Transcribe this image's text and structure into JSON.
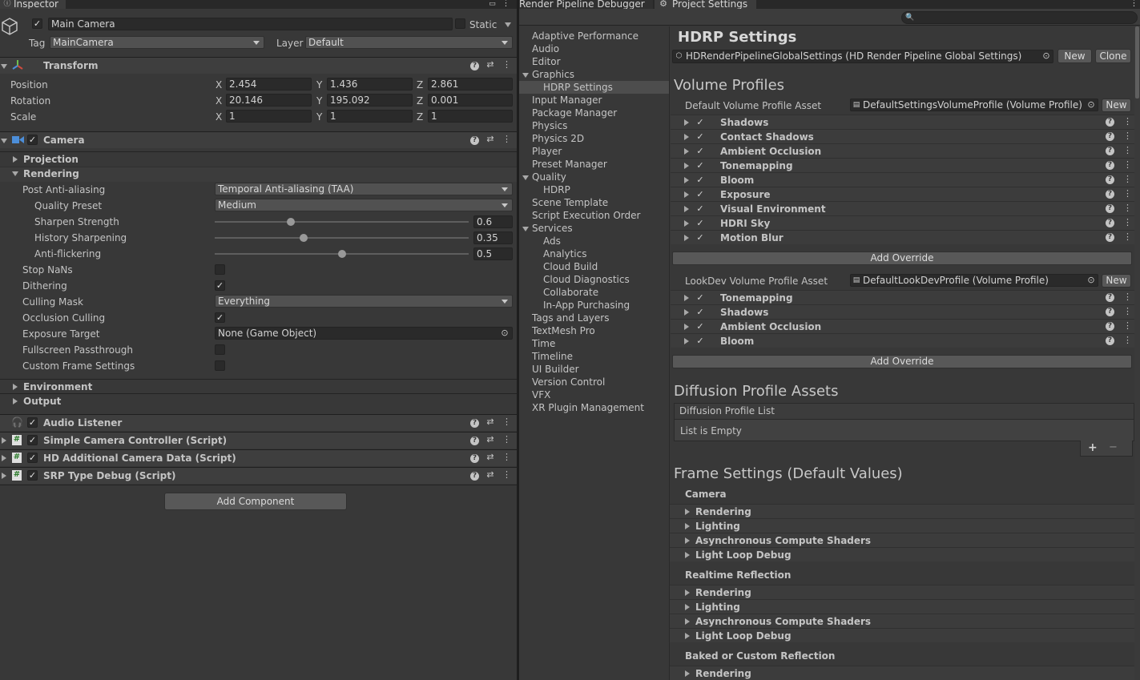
{
  "inspector": {
    "tab": "Inspector",
    "object_name": "Main Camera",
    "static_label": "Static",
    "tag_label": "Tag",
    "tag_value": "MainCamera",
    "layer_label": "Layer",
    "layer_value": "Default",
    "transform": {
      "title": "Transform",
      "position_label": "Position",
      "rotation_label": "Rotation",
      "scale_label": "Scale",
      "axis_x": "X",
      "axis_y": "Y",
      "axis_z": "Z",
      "position": [
        "2.454",
        "1.436",
        "2.861"
      ],
      "rotation": [
        "20.146",
        "195.092",
        "0.001"
      ],
      "scale": [
        "1",
        "1",
        "1"
      ]
    },
    "camera": {
      "title": "Camera",
      "projection": "Projection",
      "rendering": "Rendering",
      "post_aa_label": "Post Anti-aliasing",
      "post_aa_value": "Temporal Anti-aliasing (TAA)",
      "quality_preset_label": "Quality Preset",
      "quality_preset_value": "Medium",
      "sharpen_label": "Sharpen Strength",
      "sharpen_value": "0.6",
      "sharpen_fraction": 0.3,
      "history_label": "History Sharpening",
      "history_value": "0.35",
      "history_fraction": 0.35,
      "antiflicker_label": "Anti-flickering",
      "antiflicker_value": "0.5",
      "antiflicker_fraction": 0.5,
      "stop_nans_label": "Stop NaNs",
      "dithering_label": "Dithering",
      "culling_mask_label": "Culling Mask",
      "culling_mask_value": "Everything",
      "occlusion_label": "Occlusion Culling",
      "exposure_target_label": "Exposure Target",
      "exposure_target_value": "None (Game Object)",
      "fullscreen_label": "Fullscreen Passthrough",
      "custom_frame_label": "Custom Frame Settings",
      "environment": "Environment",
      "output": "Output"
    },
    "components": {
      "audio_listener": "Audio Listener",
      "simple_camera": "Simple Camera Controller (Script)",
      "hd_additional": "HD Additional Camera Data (Script)",
      "srp_debug": "SRP Type Debug (Script)"
    },
    "add_component": "Add Component"
  },
  "tabs": {
    "render_pipeline_debugger": "Render Pipeline Debugger",
    "project_settings": "Project Settings"
  },
  "settings_nav": {
    "items": [
      {
        "label": "Adaptive Performance",
        "indent": 0
      },
      {
        "label": "Audio",
        "indent": 0
      },
      {
        "label": "Editor",
        "indent": 0
      },
      {
        "label": "Graphics",
        "indent": 0,
        "fold": "down"
      },
      {
        "label": "HDRP Settings",
        "indent": 1,
        "selected": true
      },
      {
        "label": "Input Manager",
        "indent": 0
      },
      {
        "label": "Package Manager",
        "indent": 0
      },
      {
        "label": "Physics",
        "indent": 0
      },
      {
        "label": "Physics 2D",
        "indent": 0
      },
      {
        "label": "Player",
        "indent": 0
      },
      {
        "label": "Preset Manager",
        "indent": 0
      },
      {
        "label": "Quality",
        "indent": 0,
        "fold": "down"
      },
      {
        "label": "HDRP",
        "indent": 1
      },
      {
        "label": "Scene Template",
        "indent": 0
      },
      {
        "label": "Script Execution Order",
        "indent": 0
      },
      {
        "label": "Services",
        "indent": 0,
        "fold": "down"
      },
      {
        "label": "Ads",
        "indent": 1
      },
      {
        "label": "Analytics",
        "indent": 1
      },
      {
        "label": "Cloud Build",
        "indent": 1
      },
      {
        "label": "Cloud Diagnostics",
        "indent": 1
      },
      {
        "label": "Collaborate",
        "indent": 1
      },
      {
        "label": "In-App Purchasing",
        "indent": 1
      },
      {
        "label": "Tags and Layers",
        "indent": 0
      },
      {
        "label": "TextMesh Pro",
        "indent": 0
      },
      {
        "label": "Time",
        "indent": 0
      },
      {
        "label": "Timeline",
        "indent": 0
      },
      {
        "label": "UI Builder",
        "indent": 0
      },
      {
        "label": "Version Control",
        "indent": 0
      },
      {
        "label": "VFX",
        "indent": 0
      },
      {
        "label": "XR Plugin Management",
        "indent": 0
      }
    ]
  },
  "hdrp": {
    "title": "HDRP Settings",
    "global_asset": "HDRenderPipelineGlobalSettings (HD Render Pipeline Global Settings)",
    "new_label": "New",
    "clone_label": "Clone",
    "volume_profiles_title": "Volume Profiles",
    "default_profile_label": "Default Volume Profile Asset",
    "default_profile_value": "DefaultSettingsVolumeProfile (Volume Profile)",
    "default_overrides": [
      "Shadows",
      "Contact Shadows",
      "Ambient Occlusion",
      "Tonemapping",
      "Bloom",
      "Exposure",
      "Visual Environment",
      "HDRI Sky",
      "Motion Blur"
    ],
    "add_override": "Add Override",
    "lookdev_label": "LookDev Volume Profile Asset",
    "lookdev_value": "DefaultLookDevProfile (Volume Profile)",
    "lookdev_overrides": [
      "Tonemapping",
      "Shadows",
      "Ambient Occlusion",
      "Bloom"
    ],
    "diffusion_title": "Diffusion Profile Assets",
    "diffusion_list_label": "Diffusion Profile List",
    "diffusion_empty": "List is Empty",
    "plus": "+",
    "minus": "−",
    "frame_settings_title": "Frame Settings (Default Values)",
    "groups": [
      {
        "title": "Camera",
        "items": [
          "Rendering",
          "Lighting",
          "Asynchronous Compute Shaders",
          "Light Loop Debug"
        ]
      },
      {
        "title": "Realtime Reflection",
        "items": [
          "Rendering",
          "Lighting",
          "Asynchronous Compute Shaders",
          "Light Loop Debug"
        ]
      },
      {
        "title": "Baked or Custom Reflection",
        "items": [
          "Rendering"
        ]
      }
    ]
  },
  "colors": {
    "panel_bg": "#383838",
    "header_bg": "#3e3e3e",
    "field_bg": "#2a2a2a",
    "selection": "#4d4d4d",
    "accent_blue": "#4c8ed9"
  }
}
